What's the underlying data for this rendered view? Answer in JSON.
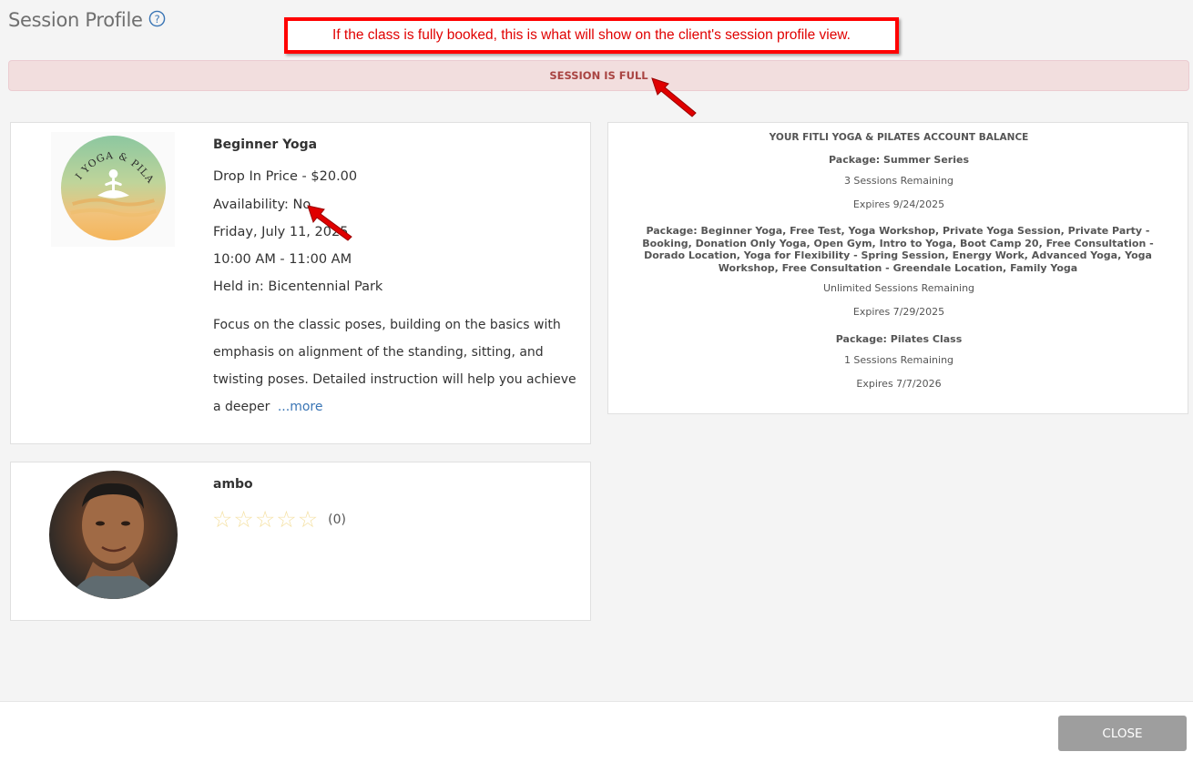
{
  "header": {
    "title": "Session Profile"
  },
  "annotation": {
    "text": "If the class is fully booked, this is what will show on the client's session profile view."
  },
  "banner": {
    "text": "SESSION IS FULL"
  },
  "session": {
    "name": "Beginner Yoga",
    "logo_text": "FITLI YOGA & PILATES",
    "price": "Drop In Price - $20.00",
    "availability": "Availability: No",
    "date": "Friday, July 11, 2025",
    "time": "10:00 AM - 11:00 AM",
    "location": "Held in: Bicentennial Park",
    "description": "Focus on the classic poses, building on the basics with emphasis on alignment of the standing, sitting, and twisting poses. Detailed instruction will help you achieve a deeper",
    "more_label": "...more"
  },
  "staff": {
    "name": "ambo",
    "rating": 0,
    "rating_count": "(0)"
  },
  "balance": {
    "title": "YOUR FITLI YOGA & PILATES ACCOUNT BALANCE",
    "packages": [
      {
        "name": "Package: Summer Series",
        "remaining": "3 Sessions Remaining",
        "expires": "Expires 9/24/2025"
      },
      {
        "name": "Package: Beginner Yoga, Free Test, Yoga Workshop, Private Yoga Session, Private Party - Booking, Donation Only Yoga, Open Gym, Intro to Yoga, Boot Camp 20, Free Consultation - Dorado Location, Yoga for Flexibility - Spring Session, Energy Work, Advanced Yoga, Yoga Workshop, Free Consultation - Greendale Location, Family Yoga",
        "remaining": "Unlimited Sessions Remaining",
        "expires": "Expires 7/29/2025"
      },
      {
        "name": "Package: Pilates Class",
        "remaining": "1 Sessions Remaining",
        "expires": "Expires 7/7/2026"
      }
    ]
  },
  "footer": {
    "close_label": "CLOSE"
  },
  "colors": {
    "banner_bg": "#f2dede",
    "banner_text": "#a94442",
    "annotation": "#ff0000",
    "link": "#3a75b5",
    "close_btn": "#9e9e9e"
  }
}
